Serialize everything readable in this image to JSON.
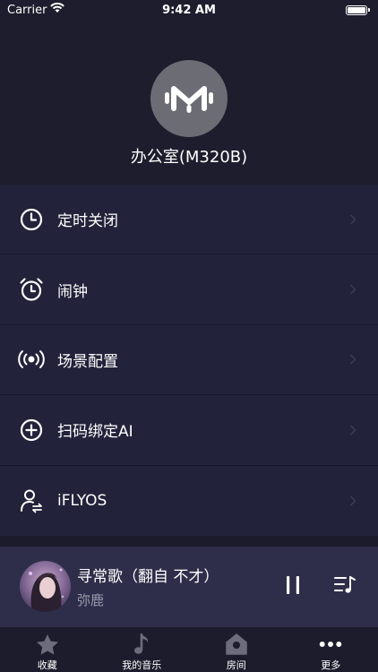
{
  "status_bar": {
    "carrier": "Carrier",
    "time": "9:42 AM",
    "battery_level": 1.0
  },
  "device": {
    "name": "办公室(M320B)",
    "logo_icon": "device-logo-icon"
  },
  "menu": {
    "items": [
      {
        "label": "定时关闭",
        "icon": "clock-icon"
      },
      {
        "label": "闹钟",
        "icon": "alarm-clock-icon"
      },
      {
        "label": "场景配置",
        "icon": "broadcast-icon"
      },
      {
        "label": "扫码绑定AI",
        "icon": "plus-circle-icon"
      },
      {
        "label": "iFLYOS",
        "icon": "user-swap-icon"
      }
    ]
  },
  "player": {
    "title": "寻常歌（翻自 不才）",
    "artist": "弥鹿",
    "state": "playing"
  },
  "tabs": [
    {
      "label": "收藏",
      "icon": "star-icon"
    },
    {
      "label": "我的音乐",
      "icon": "music-note-icon"
    },
    {
      "label": "房间",
      "icon": "house-icon"
    },
    {
      "label": "更多",
      "icon": "more-dots-icon"
    }
  ],
  "colors": {
    "background": "#1b1b2b",
    "menu_background": "#22223a",
    "player_background": "#2e2e4a",
    "secondary_text": "#9a9aae"
  }
}
